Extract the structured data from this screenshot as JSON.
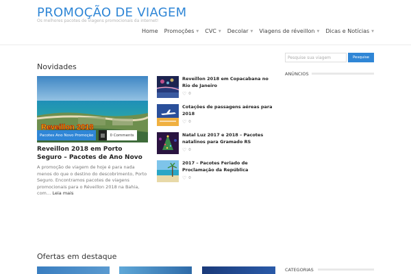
{
  "header": {
    "title": "PROMOÇÃO DE VIAGEM",
    "tagline": "Os melhores pacotes de viagens promocionais da internet!",
    "nav": [
      {
        "label": "Home",
        "has_submenu": false
      },
      {
        "label": "Promoções",
        "has_submenu": true
      },
      {
        "label": "CVC",
        "has_submenu": true
      },
      {
        "label": "Decolar",
        "has_submenu": true
      },
      {
        "label": "Viagens de réveillon",
        "has_submenu": true
      },
      {
        "label": "Dicas e Notícias",
        "has_submenu": true
      }
    ]
  },
  "news": {
    "section_title": "Novidades",
    "featured": {
      "image_caption": "Reveillon 2018",
      "tag": "Pacotes Ano Novo Promoção",
      "comments": "0 Comments",
      "title": "Reveillon 2018 em Porto Seguro – Pacotes de Ano Novo",
      "excerpt": "A promoção de viagem de hoje é para nada menos do que o destino do descobrimento, Porto Seguro. Encontramos pacotes de viagens promocionais para o Réveillon 2018 na Bahia, com…",
      "read_more": "Leia mais"
    },
    "items": [
      {
        "title": "Reveillon 2018 em Copacabana no Rio de Janeiro",
        "likes": "0"
      },
      {
        "title": "Cotações de passagens aéreas para 2018",
        "likes": "0"
      },
      {
        "title": "Natal Luz 2017 e 2018 – Pacotes natalinos para Gramado RS",
        "likes": "0"
      },
      {
        "title": "2017 – Pacotes Feriado de Proclamação da República",
        "likes": "0"
      }
    ]
  },
  "offers": {
    "section_title": "Ofertas em destaque"
  },
  "sidebar": {
    "search_placeholder": "Pesquise sua viagem",
    "search_button": "Pesquise",
    "ads_title": "ANÚNCIOS",
    "categories_title": "CATEGORIAS"
  },
  "colors": {
    "accent": "#2f86d6",
    "tag_bg": "#2f86d6",
    "comments_icon_bg": "#222222"
  }
}
